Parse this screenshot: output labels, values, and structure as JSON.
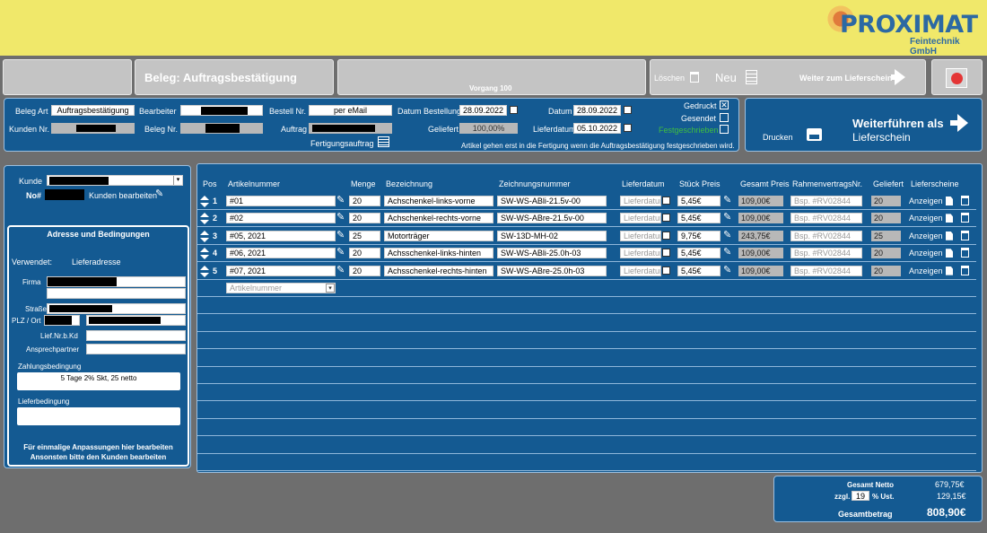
{
  "logo": {
    "name": "PROXIMAT",
    "sub": "Feintechnik GmbH"
  },
  "toolbar": {
    "beleg_title": "Beleg: Auftragsbestätigung",
    "vorgang": "Vorgang 100",
    "loeschen": "Löschen",
    "neu": "Neu",
    "weiter_lieferschein": "Weiter zum Lieferschein"
  },
  "header": {
    "beleg_art_label": "Beleg Art",
    "beleg_art": "Auftragsbestätigung",
    "bearbeiter_label": "Bearbeiter",
    "bestell_nr_label": "Bestell Nr.",
    "bestell_nr": "per eMail",
    "datum_bestellung_label": "Datum Bestellung",
    "datum_bestellung": "28.09.2022",
    "datum_label": "Datum",
    "datum": "28.09.2022",
    "kunden_nr_label": "Kunden Nr.",
    "beleg_nr_label": "Beleg Nr.",
    "auftrag_label": "Auftrag",
    "geliefert_label": "Geliefert",
    "geliefert": "100,00%",
    "lieferdatum_label": "Lieferdatum",
    "lieferdatum": "05.10.2022",
    "fertigungsauftrag": "Fertigungsauftrag",
    "gedruckt": "Gedruckt",
    "gesendet": "Gesendet",
    "festgeschrieben": "Festgeschrieben",
    "hinweis": "Artikel gehen erst in die Fertigung wenn die Auftragsbestätigung festgeschrieben wird."
  },
  "weiterfuehren": {
    "drucken": "Drucken",
    "title": "Weiterführen als",
    "sub": "Lieferschein"
  },
  "kunde": {
    "kunde_label": "Kunde",
    "no_label": "No#",
    "bearbeiten": "Kunden bearbeiten",
    "adresse_title": "Adresse und Bedingungen",
    "verwendet_label": "Verwendet:",
    "verwendet": "Lieferadresse",
    "firma_label": "Firma",
    "strasse_label": "Straße",
    "plz_label": "PLZ / Ort",
    "lief_label": "Lief.Nr.b.Kd",
    "ansprech_label": "Ansprechpartner",
    "zahlung_label": "Zahlungsbedingung",
    "zahlung": "5 Tage 2% Skt, 25 netto",
    "liefer_label": "Lieferbedingung",
    "hinweis1": "Für einmalige Anpassungen hier bearbeiten",
    "hinweis2": "Ansonsten bitte den Kunden bearbeiten"
  },
  "table": {
    "headers": [
      "Pos",
      "Artikelnummer",
      "Menge",
      "Bezeichnung",
      "Zeichnungsnummer",
      "Lieferdatum",
      "Stück Preis",
      "Gesamt Preis",
      "RahmenvertragsNr.",
      "Geliefert",
      "Lieferscheine"
    ],
    "lieferdatum_placeholder": "Lieferdatum",
    "rahmen_placeholder": "Bsp. #RV02844",
    "anzeigen": "Anzeigen",
    "new_placeholder": "Artikelnummer",
    "rows": [
      {
        "pos": "1",
        "art": "#01",
        "menge": "20",
        "bez": "Achschenkel-links-vorne",
        "zeich": "SW-WS-ABli-21.5v-00",
        "preis": "5,45€",
        "gesamt": "109,00€",
        "geliefert": "20"
      },
      {
        "pos": "2",
        "art": "#02",
        "menge": "20",
        "bez": "Achschenkel-rechts-vorne",
        "zeich": "SW-WS-ABre-21.5v-00",
        "preis": "5,45€",
        "gesamt": "109,00€",
        "geliefert": "20"
      },
      {
        "pos": "3",
        "art": "#05, 2021",
        "menge": "25",
        "bez": "Motorträger",
        "zeich": "SW-13D-MH-02",
        "preis": "9,75€",
        "gesamt": "243,75€",
        "geliefert": "25"
      },
      {
        "pos": "4",
        "art": "#06, 2021",
        "menge": "20",
        "bez": "Achsschenkel-links-hinten",
        "zeich": "SW-WS-ABli-25.0h-03",
        "preis": "5,45€",
        "gesamt": "109,00€",
        "geliefert": "20"
      },
      {
        "pos": "5",
        "art": "#07, 2021",
        "menge": "20",
        "bez": "Achsschenkel-rechts-hinten",
        "zeich": "SW-WS-ABre-25.0h-03",
        "preis": "5,45€",
        "gesamt": "109,00€",
        "geliefert": "20"
      }
    ]
  },
  "totals": {
    "netto_label": "Gesamt Netto",
    "netto": "679,75€",
    "zzgl": "zzgl.",
    "ust_pct": "19",
    "ust_label": "% Ust.",
    "ust": "129,15€",
    "betrag_label": "Gesamtbetrag",
    "betrag": "808,90€"
  }
}
